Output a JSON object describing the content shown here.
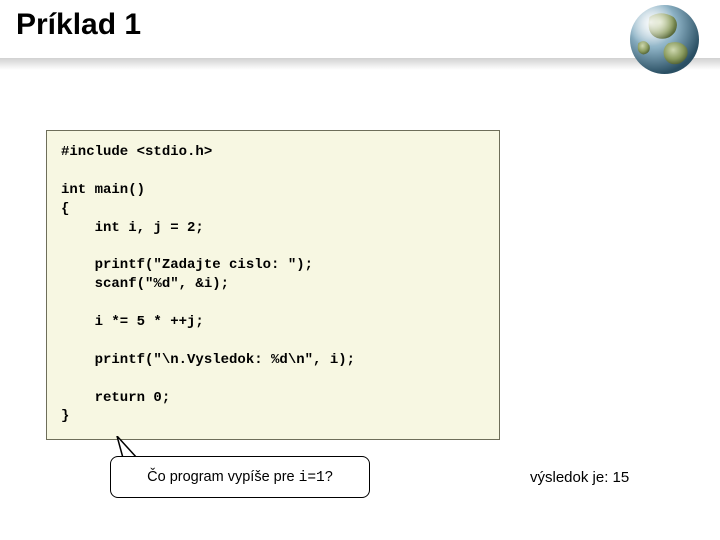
{
  "title": "Príklad 1",
  "code": "#include <stdio.h>\n\nint main()\n{\n    int i, j = 2;\n\n    printf(\"Zadajte cislo: \");\n    scanf(\"%d\", &i);\n\n    i *= 5 * ++j;\n\n    printf(\"\\n.Vysledok: %d\\n\", i);\n\n    return 0;\n}",
  "callout": {
    "prefix": "Čo program vypíše pre ",
    "mono": "i=1",
    "suffix": "?"
  },
  "answer": "výsledok je: 15"
}
